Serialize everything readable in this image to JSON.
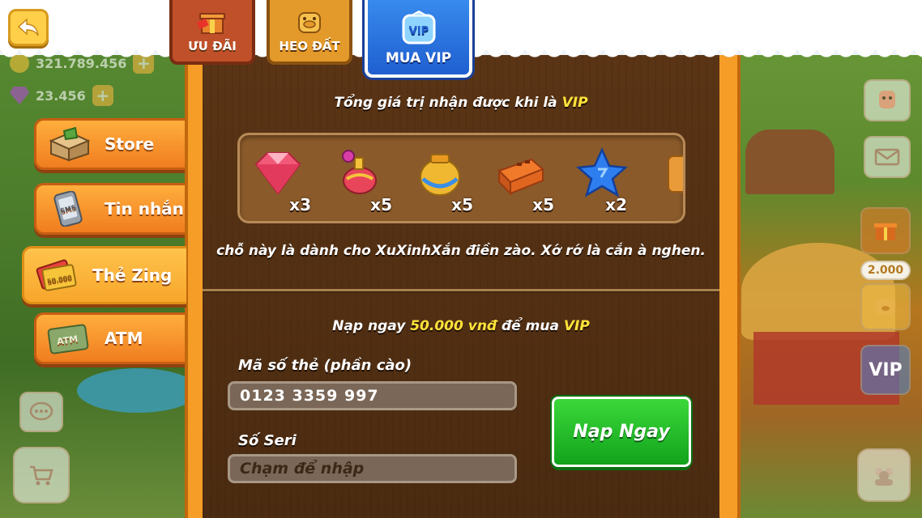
{
  "header": {
    "back_icon": "back-arrow-icon",
    "tabs": [
      {
        "label": "ƯU ĐÃI",
        "icon": "gift-sale-icon"
      },
      {
        "label": "HEO ĐẤT",
        "icon": "piggy-bank-icon"
      },
      {
        "label": "MUA VIP",
        "icon": "vip-badge-icon",
        "active": true
      }
    ]
  },
  "currency": {
    "coins": "321.789.456",
    "gems": "23.456"
  },
  "menu": {
    "items": [
      {
        "label": "Store",
        "icon": "store-box-icon"
      },
      {
        "label": "Tin nhắn",
        "icon": "sms-phone-icon"
      },
      {
        "label": "Thẻ Zing",
        "icon": "zing-card-icon",
        "active": true
      },
      {
        "label": "ATM",
        "icon": "atm-card-icon"
      }
    ]
  },
  "vip": {
    "reward_title_prefix": "Tổng giá trị nhận được khi là",
    "reward_title_highlight": "VIP",
    "rewards": [
      {
        "name": "ruby",
        "qty": "x3"
      },
      {
        "name": "potion",
        "qty": "x5"
      },
      {
        "name": "magic-jar",
        "qty": "x5"
      },
      {
        "name": "brick-toolbox",
        "qty": "x5"
      },
      {
        "name": "blue-star",
        "qty": "x2"
      }
    ],
    "note": "chỗ này là dành cho XuXinhXắn điền zào. Xớ rớ là cắn à nghen.",
    "topup_prefix": "Nạp ngay",
    "topup_amount": "50.000 vnđ",
    "topup_middle": "để mua",
    "topup_vip": "VIP",
    "card_code_label": "Mã số thẻ (phần cào)",
    "card_code_value": "0123 3359 997",
    "serial_label": "Số Seri",
    "serial_placeholder": "Chạm để nhập",
    "submit_label": "Nạp Ngay"
  },
  "side": {
    "heo_price": "2.000",
    "vip_label": "VIP"
  },
  "colors": {
    "accent_yellow": "#ffe33a",
    "panel_brown": "#4b2b11",
    "button_green": "#12a31c",
    "tab_blue": "#1f5fd0"
  }
}
